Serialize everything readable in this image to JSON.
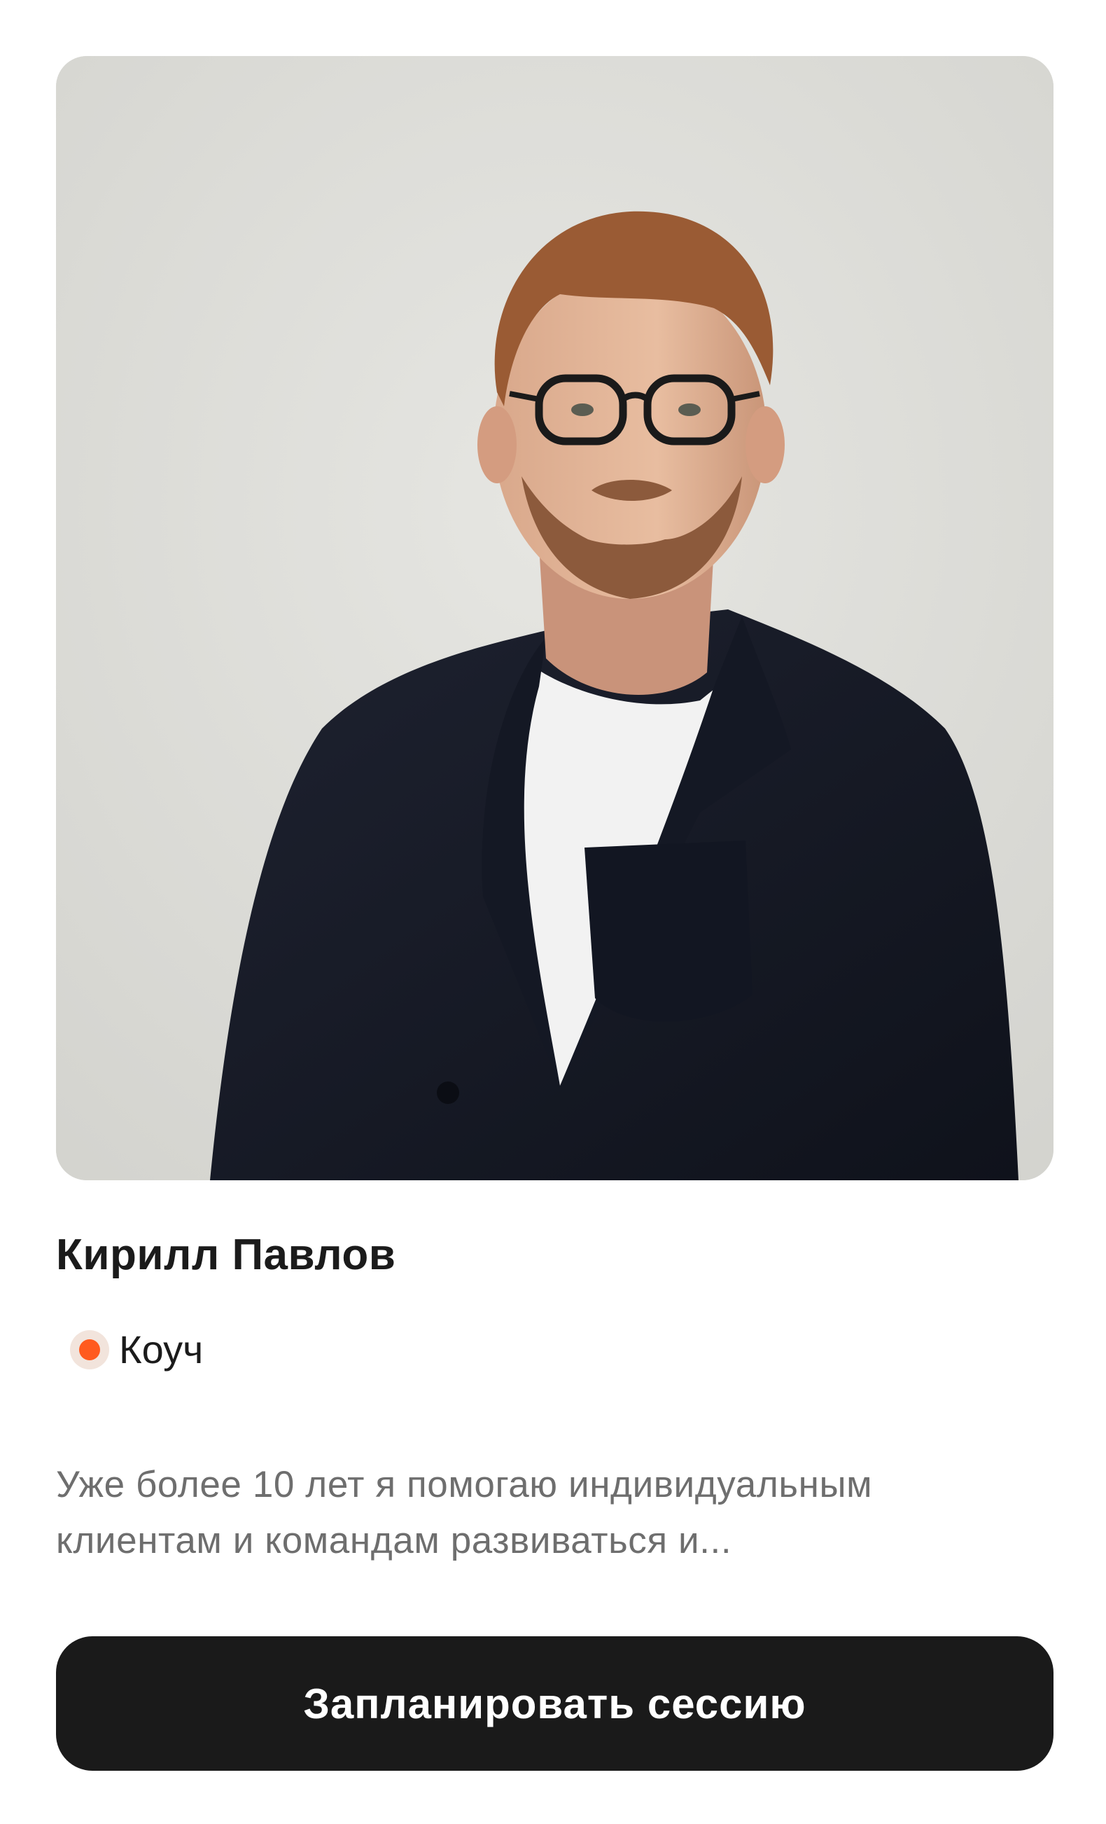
{
  "profile": {
    "name": "Кирилл Павлов",
    "role": "Коуч",
    "description_lines": [
      "Уже более 10 лет я помогаю индивидуальным",
      "клиентам и командам развиваться и..."
    ]
  },
  "actions": {
    "schedule_label": "Запланировать сессию"
  },
  "colors": {
    "accent": "#ff5a1f",
    "button_bg": "#1a1a1a",
    "photo_bg": "#dcdcd8"
  }
}
